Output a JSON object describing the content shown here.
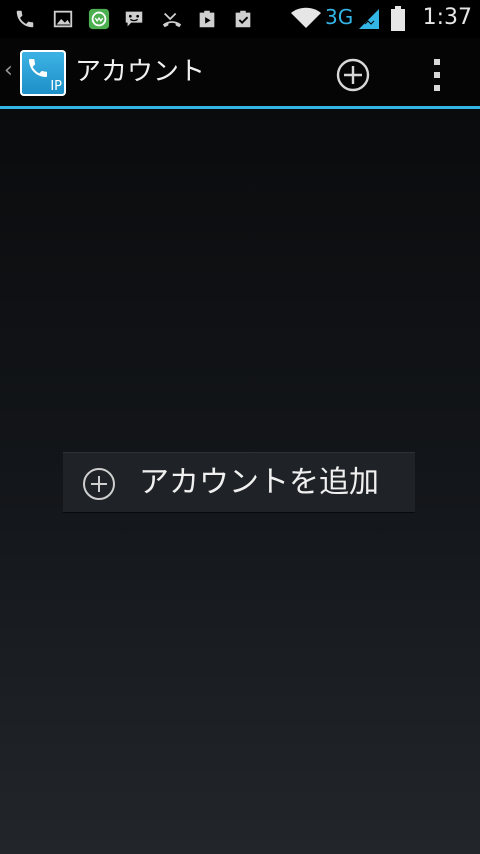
{
  "status_bar": {
    "notification_icons": [
      "phone-icon",
      "image-icon",
      "whatsapp-icon",
      "chat-icon",
      "missed-call-icon",
      "play-store-icon",
      "clipboard-check-icon"
    ],
    "network": "3G",
    "time": "1:37"
  },
  "action_bar": {
    "title": "アカウント",
    "add_icon": "add-circle-icon",
    "overflow_icon": "overflow-menu-icon",
    "app_icon_label": "IP"
  },
  "main": {
    "add_account_label": "アカウントを追加"
  },
  "colors": {
    "accent": "#33b5e5",
    "background_top": "#0a0b0d",
    "background_bottom": "#22262b",
    "button_bg": "#1f2226",
    "text": "#f0f0f0"
  }
}
